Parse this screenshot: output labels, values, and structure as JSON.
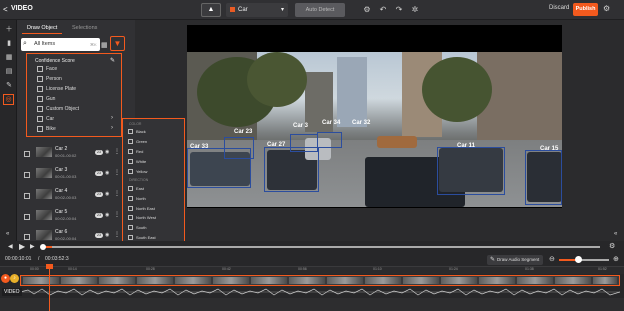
{
  "app": {
    "title": "VIDEO",
    "back": "<"
  },
  "toolbar": {
    "cursor": "▲",
    "class_select": "Car",
    "auto_detect": "Auto Detect",
    "discard": "Discard",
    "publish": "Publish"
  },
  "panel": {
    "tabs": [
      "Draw Object",
      "Selections"
    ],
    "search_value": "All Items",
    "search_kbd": "⌘K"
  },
  "filter": {
    "title": "Confidence Score",
    "items": [
      {
        "label": "Face",
        "arrow": false
      },
      {
        "label": "Person",
        "arrow": false
      },
      {
        "label": "License Plate",
        "arrow": false
      },
      {
        "label": "Gun",
        "arrow": false
      },
      {
        "label": "Custom Object",
        "arrow": false
      },
      {
        "label": "Car",
        "arrow": true
      },
      {
        "label": "Bike",
        "arrow": true
      }
    ]
  },
  "subfilter": {
    "color_header": "COLOR",
    "colors": [
      "Black",
      "Green",
      "Red",
      "White",
      "Yellow"
    ],
    "direction_header": "DIRECTION",
    "directions": [
      "East",
      "North",
      "North East",
      "North West",
      "South",
      "South East",
      "South West",
      "West"
    ]
  },
  "objects": [
    {
      "name": "Car 2",
      "time": "00:01-00:02",
      "badge": "23"
    },
    {
      "name": "Car 3",
      "time": "00:01-00:03",
      "badge": "23"
    },
    {
      "name": "Car 4",
      "time": "00:02-00:03",
      "badge": "23"
    },
    {
      "name": "Car 5",
      "time": "00:02-00:04",
      "badge": "23"
    },
    {
      "name": "Car 6",
      "time": "00:02-00:04",
      "badge": "23"
    }
  ],
  "boxes": [
    "Car 33",
    "Car 23",
    "Car 27",
    "Car 3",
    "Car 34",
    "Car 32",
    "Car 11",
    "Car 15"
  ],
  "playback": {
    "current": "00:00:10:01",
    "separator": "/",
    "total": "00:03:52:3",
    "draw_audio": "Draw Audio Segment"
  },
  "ruler": [
    "00:00",
    "00:14",
    "00:28",
    "00:42",
    "00:56",
    "01:10",
    "01:24",
    "01:38",
    "01:52"
  ],
  "track": {
    "label": "VIDEO"
  }
}
